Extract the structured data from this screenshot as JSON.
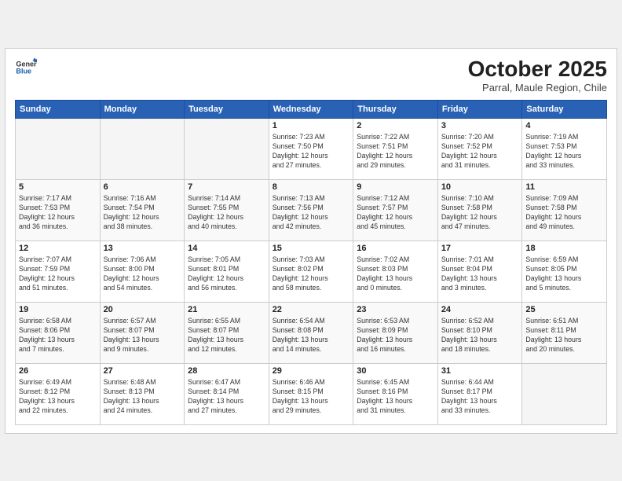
{
  "header": {
    "logo_line1": "General",
    "logo_line2": "Blue",
    "month_year": "October 2025",
    "location": "Parral, Maule Region, Chile"
  },
  "weekdays": [
    "Sunday",
    "Monday",
    "Tuesday",
    "Wednesday",
    "Thursday",
    "Friday",
    "Saturday"
  ],
  "weeks": [
    [
      {
        "day": "",
        "info": ""
      },
      {
        "day": "",
        "info": ""
      },
      {
        "day": "",
        "info": ""
      },
      {
        "day": "1",
        "info": "Sunrise: 7:23 AM\nSunset: 7:50 PM\nDaylight: 12 hours\nand 27 minutes."
      },
      {
        "day": "2",
        "info": "Sunrise: 7:22 AM\nSunset: 7:51 PM\nDaylight: 12 hours\nand 29 minutes."
      },
      {
        "day": "3",
        "info": "Sunrise: 7:20 AM\nSunset: 7:52 PM\nDaylight: 12 hours\nand 31 minutes."
      },
      {
        "day": "4",
        "info": "Sunrise: 7:19 AM\nSunset: 7:53 PM\nDaylight: 12 hours\nand 33 minutes."
      }
    ],
    [
      {
        "day": "5",
        "info": "Sunrise: 7:17 AM\nSunset: 7:53 PM\nDaylight: 12 hours\nand 36 minutes."
      },
      {
        "day": "6",
        "info": "Sunrise: 7:16 AM\nSunset: 7:54 PM\nDaylight: 12 hours\nand 38 minutes."
      },
      {
        "day": "7",
        "info": "Sunrise: 7:14 AM\nSunset: 7:55 PM\nDaylight: 12 hours\nand 40 minutes."
      },
      {
        "day": "8",
        "info": "Sunrise: 7:13 AM\nSunset: 7:56 PM\nDaylight: 12 hours\nand 42 minutes."
      },
      {
        "day": "9",
        "info": "Sunrise: 7:12 AM\nSunset: 7:57 PM\nDaylight: 12 hours\nand 45 minutes."
      },
      {
        "day": "10",
        "info": "Sunrise: 7:10 AM\nSunset: 7:58 PM\nDaylight: 12 hours\nand 47 minutes."
      },
      {
        "day": "11",
        "info": "Sunrise: 7:09 AM\nSunset: 7:58 PM\nDaylight: 12 hours\nand 49 minutes."
      }
    ],
    [
      {
        "day": "12",
        "info": "Sunrise: 7:07 AM\nSunset: 7:59 PM\nDaylight: 12 hours\nand 51 minutes."
      },
      {
        "day": "13",
        "info": "Sunrise: 7:06 AM\nSunset: 8:00 PM\nDaylight: 12 hours\nand 54 minutes."
      },
      {
        "day": "14",
        "info": "Sunrise: 7:05 AM\nSunset: 8:01 PM\nDaylight: 12 hours\nand 56 minutes."
      },
      {
        "day": "15",
        "info": "Sunrise: 7:03 AM\nSunset: 8:02 PM\nDaylight: 12 hours\nand 58 minutes."
      },
      {
        "day": "16",
        "info": "Sunrise: 7:02 AM\nSunset: 8:03 PM\nDaylight: 13 hours\nand 0 minutes."
      },
      {
        "day": "17",
        "info": "Sunrise: 7:01 AM\nSunset: 8:04 PM\nDaylight: 13 hours\nand 3 minutes."
      },
      {
        "day": "18",
        "info": "Sunrise: 6:59 AM\nSunset: 8:05 PM\nDaylight: 13 hours\nand 5 minutes."
      }
    ],
    [
      {
        "day": "19",
        "info": "Sunrise: 6:58 AM\nSunset: 8:06 PM\nDaylight: 13 hours\nand 7 minutes."
      },
      {
        "day": "20",
        "info": "Sunrise: 6:57 AM\nSunset: 8:07 PM\nDaylight: 13 hours\nand 9 minutes."
      },
      {
        "day": "21",
        "info": "Sunrise: 6:55 AM\nSunset: 8:07 PM\nDaylight: 13 hours\nand 12 minutes."
      },
      {
        "day": "22",
        "info": "Sunrise: 6:54 AM\nSunset: 8:08 PM\nDaylight: 13 hours\nand 14 minutes."
      },
      {
        "day": "23",
        "info": "Sunrise: 6:53 AM\nSunset: 8:09 PM\nDaylight: 13 hours\nand 16 minutes."
      },
      {
        "day": "24",
        "info": "Sunrise: 6:52 AM\nSunset: 8:10 PM\nDaylight: 13 hours\nand 18 minutes."
      },
      {
        "day": "25",
        "info": "Sunrise: 6:51 AM\nSunset: 8:11 PM\nDaylight: 13 hours\nand 20 minutes."
      }
    ],
    [
      {
        "day": "26",
        "info": "Sunrise: 6:49 AM\nSunset: 8:12 PM\nDaylight: 13 hours\nand 22 minutes."
      },
      {
        "day": "27",
        "info": "Sunrise: 6:48 AM\nSunset: 8:13 PM\nDaylight: 13 hours\nand 24 minutes."
      },
      {
        "day": "28",
        "info": "Sunrise: 6:47 AM\nSunset: 8:14 PM\nDaylight: 13 hours\nand 27 minutes."
      },
      {
        "day": "29",
        "info": "Sunrise: 6:46 AM\nSunset: 8:15 PM\nDaylight: 13 hours\nand 29 minutes."
      },
      {
        "day": "30",
        "info": "Sunrise: 6:45 AM\nSunset: 8:16 PM\nDaylight: 13 hours\nand 31 minutes."
      },
      {
        "day": "31",
        "info": "Sunrise: 6:44 AM\nSunset: 8:17 PM\nDaylight: 13 hours\nand 33 minutes."
      },
      {
        "day": "",
        "info": ""
      }
    ]
  ]
}
